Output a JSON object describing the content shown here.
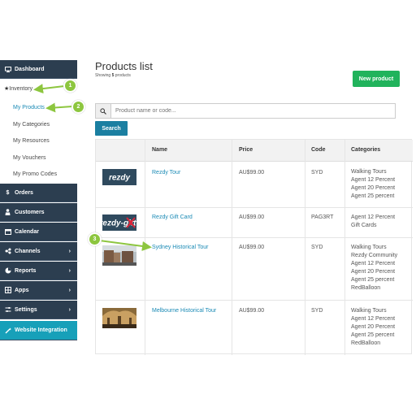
{
  "sidebar": {
    "dashboard": "Dashboard",
    "inventory": "Inventory",
    "sub_items": [
      "My Products",
      "My Categories",
      "My Resources",
      "My Vouchers",
      "My Promo Codes"
    ],
    "orders": "Orders",
    "customers": "Customers",
    "calendar": "Calendar",
    "channels": "Channels",
    "reports": "Reports",
    "apps": "Apps",
    "settings": "Settings",
    "website_integration": "Website Integration"
  },
  "main": {
    "title": "Products list",
    "showing_prefix": "Showing",
    "showing_count": "5",
    "showing_suffix": "products",
    "new_product_label": "New product",
    "search_placeholder": "Product name or code...",
    "search_button": "Search"
  },
  "table": {
    "headers": [
      "Name",
      "Price",
      "Code",
      "Categories"
    ],
    "rows": [
      {
        "name": "Rezdy Tour",
        "price": "AU$99.00",
        "code": "SYD",
        "categories": [
          "Walking Tours",
          "Agent 12 Percent",
          "Agent 20 Percent",
          "Agent 25 percent"
        ]
      },
      {
        "name": "Rezdy Gift Card",
        "price": "AU$99.00",
        "code": "PAG3RT",
        "categories": [
          "Agent 12 Percent",
          "Gift Cards"
        ]
      },
      {
        "name": "Sydney Historical Tour",
        "price": "AU$99.00",
        "code": "SYD",
        "categories": [
          "Walking Tours",
          "Rezdy Community",
          "Agent 12 Percent",
          "Agent 20 Percent",
          "Agent 25 percent",
          "RedBalloon"
        ]
      },
      {
        "name": "Melbourne Historical Tour",
        "price": "AU$99.00",
        "code": "SYD",
        "categories": [
          "Walking Tours",
          "Agent 12 Percent",
          "Agent 20 Percent",
          "Agent 25 percent",
          "RedBalloon"
        ]
      }
    ]
  },
  "thumbs": [
    "rezdy",
    "rezdy-gift"
  ],
  "annotations": [
    "1",
    "2",
    "3"
  ],
  "colors": {
    "sidebar_dark": "#2c3e50",
    "sidebar_active": "#17a0b9",
    "link": "#1a8ab5",
    "new_product": "#21b35c",
    "search_button": "#1b7fa1",
    "annotation": "#8dc63f"
  }
}
